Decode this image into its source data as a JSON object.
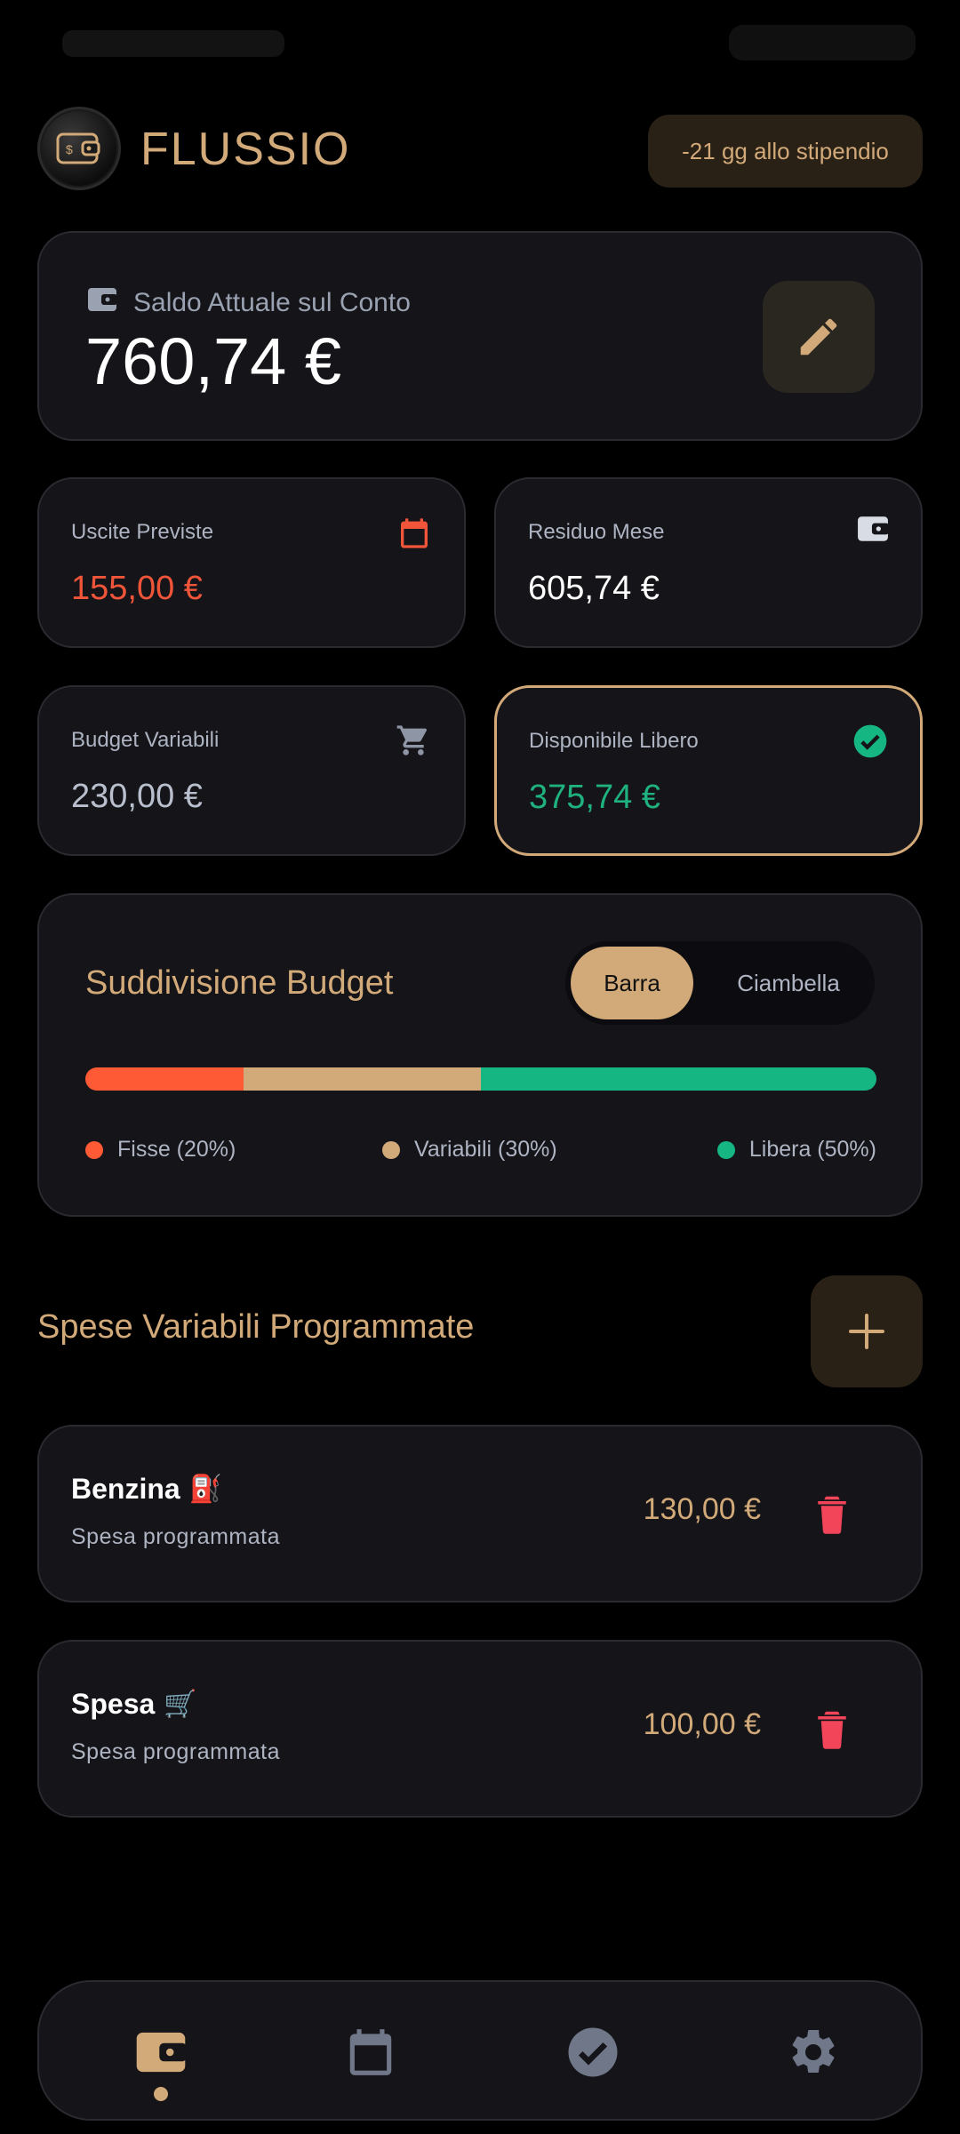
{
  "app": {
    "title": "FLUSSIO",
    "payday_badge": "-21 gg allo stipendio"
  },
  "balance": {
    "label": "Saldo Attuale sul Conto",
    "value": "760,74 €"
  },
  "stats": {
    "uscite": {
      "label": "Uscite Previste",
      "value": "155,00 €",
      "icon": "calendar-icon",
      "color": "#f0553a"
    },
    "residuo": {
      "label": "Residuo Mese",
      "value": "605,74 €",
      "icon": "wallet-icon",
      "color": "#ffffff"
    },
    "budget": {
      "label": "Budget Variabili",
      "value": "230,00 €",
      "icon": "cart-icon",
      "color": "#b9bfcc"
    },
    "libero": {
      "label": "Disponibile Libero",
      "value": "375,74 €",
      "icon": "check-circle-icon",
      "color": "#1fb27e"
    }
  },
  "breakdown": {
    "title": "Suddivisione Budget",
    "toggle": {
      "bar": "Barra",
      "donut": "Ciambella",
      "selected": "Barra"
    },
    "segments": [
      {
        "label": "Fisse (20%)",
        "percent": 20,
        "color": "#ff5a36"
      },
      {
        "label": "Variabili (30%)",
        "percent": 30,
        "color": "#d2a978"
      },
      {
        "label": "Libera (50%)",
        "percent": 50,
        "color": "#16b682"
      }
    ]
  },
  "scheduled": {
    "title": "Spese Variabili Programmate",
    "items": [
      {
        "name": "Benzina",
        "emoji": "⛽",
        "subtitle": "Spesa programmata",
        "amount": "130,00 €"
      },
      {
        "name": "Spesa",
        "emoji": "🛒",
        "subtitle": "Spesa programmata",
        "amount": "100,00 €"
      }
    ]
  },
  "nav": {
    "items": [
      "wallet-icon",
      "calendar-icon",
      "check-circle-icon",
      "gear-icon"
    ],
    "active": "wallet-icon"
  },
  "colors": {
    "accent": "#d2a978",
    "danger": "#f2455a",
    "background": "#000000",
    "card": "#141419"
  }
}
